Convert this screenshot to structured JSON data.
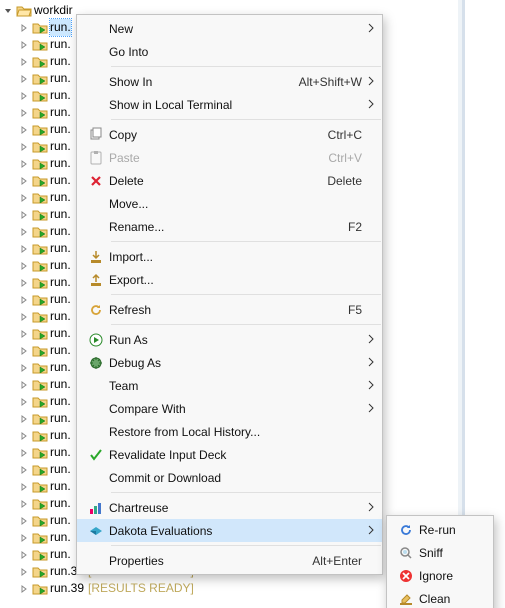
{
  "tree": {
    "root_label": "workdir",
    "item_base_label": "run.",
    "results_ready_text": "[RESULTS READY]",
    "visible_complete_items": [
      {
        "index": 38,
        "status": "RESULTS READY"
      },
      {
        "index": 39,
        "status": "RESULTS READY"
      }
    ],
    "selected_index": 0,
    "truncated_item_count": 32
  },
  "context_menu": {
    "groups": [
      [
        {
          "id": "new",
          "label": "New",
          "submenu": true
        },
        {
          "id": "gointo",
          "label": "Go Into"
        }
      ],
      [
        {
          "id": "showin",
          "label": "Show In",
          "hotkey": "Alt+Shift+W",
          "submenu": true
        },
        {
          "id": "localterm",
          "label": "Show in Local Terminal",
          "submenu": true
        }
      ],
      [
        {
          "id": "copy",
          "label": "Copy",
          "hotkey": "Ctrl+C",
          "icon": "copy"
        },
        {
          "id": "paste",
          "label": "Paste",
          "hotkey": "Ctrl+V",
          "icon": "paste",
          "disabled": true
        },
        {
          "id": "delete",
          "label": "Delete",
          "hotkey": "Delete",
          "icon": "delete"
        },
        {
          "id": "move",
          "label": "Move..."
        },
        {
          "id": "rename",
          "label": "Rename...",
          "hotkey": "F2"
        }
      ],
      [
        {
          "id": "import",
          "label": "Import...",
          "icon": "import"
        },
        {
          "id": "export",
          "label": "Export...",
          "icon": "export"
        }
      ],
      [
        {
          "id": "refresh",
          "label": "Refresh",
          "hotkey": "F5",
          "icon": "refresh"
        }
      ],
      [
        {
          "id": "runas",
          "label": "Run As",
          "submenu": true,
          "icon": "run"
        },
        {
          "id": "debugas",
          "label": "Debug As",
          "submenu": true,
          "icon": "debug"
        },
        {
          "id": "team",
          "label": "Team",
          "submenu": true
        },
        {
          "id": "compare",
          "label": "Compare With",
          "submenu": true
        },
        {
          "id": "restore",
          "label": "Restore from Local History..."
        },
        {
          "id": "revalidate",
          "label": "Revalidate Input Deck",
          "icon": "check"
        },
        {
          "id": "commit",
          "label": "Commit or Download"
        }
      ],
      [
        {
          "id": "chartreuse",
          "label": "Chartreuse",
          "submenu": true,
          "icon": "chart"
        },
        {
          "id": "dakota",
          "label": "Dakota Evaluations",
          "submenu": true,
          "icon": "dakota",
          "highlight": true
        }
      ],
      [
        {
          "id": "props",
          "label": "Properties",
          "hotkey": "Alt+Enter"
        }
      ]
    ]
  },
  "submenu_dakota": [
    {
      "id": "rerun",
      "label": "Re-run",
      "icon": "rerun"
    },
    {
      "id": "sniff",
      "label": "Sniff",
      "icon": "sniff"
    },
    {
      "id": "ignore",
      "label": "Ignore",
      "icon": "ignore"
    },
    {
      "id": "clean",
      "label": "Clean",
      "icon": "clean"
    }
  ]
}
